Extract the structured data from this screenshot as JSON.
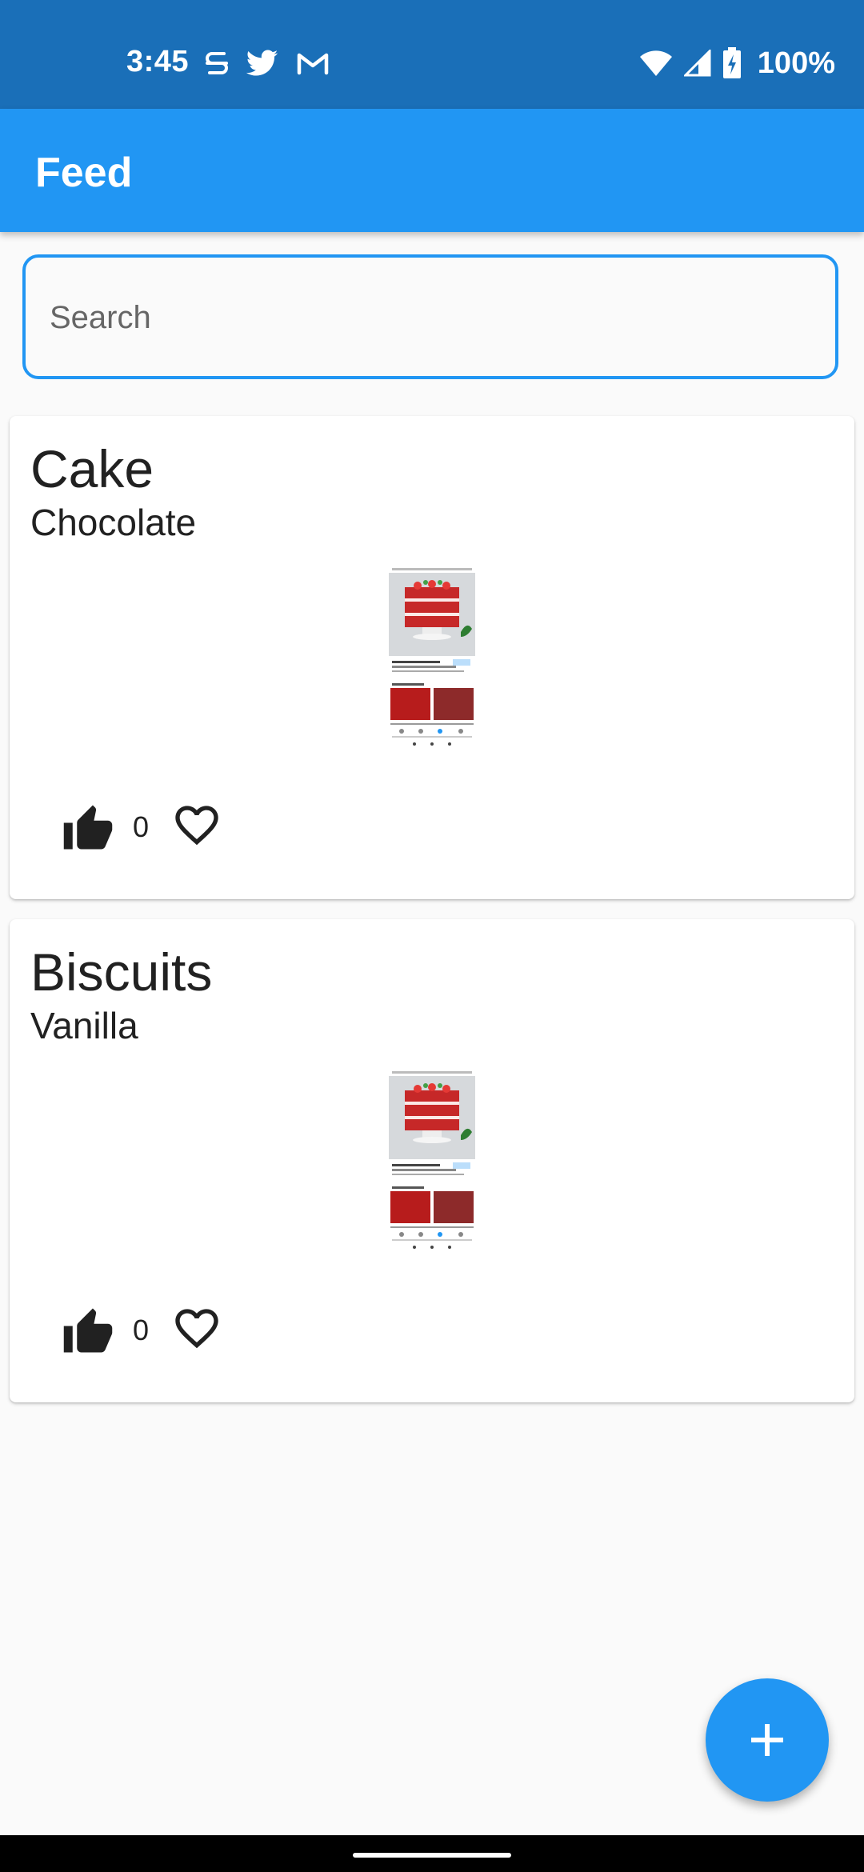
{
  "status_bar": {
    "time": "3:45",
    "notification_icons": [
      "s-icon",
      "twitter-icon",
      "gmail-icon"
    ],
    "system_icons": [
      "wifi-icon",
      "signal-icon",
      "battery-charging-icon"
    ],
    "battery": "100%"
  },
  "app_bar": {
    "title": "Feed"
  },
  "search": {
    "placeholder": "Search",
    "value": ""
  },
  "feed": {
    "items": [
      {
        "title": "Cake",
        "subtitle": "Chocolate",
        "likes": "0",
        "image": "cake-screenshot-thumbnail"
      },
      {
        "title": "Biscuits",
        "subtitle": "Vanilla",
        "likes": "0",
        "image": "cake-screenshot-thumbnail"
      }
    ]
  },
  "fab": {
    "icon": "plus-icon"
  },
  "colors": {
    "status_bar": "#1a6fb8",
    "app_bar": "#2196f3",
    "accent": "#2196f3",
    "background": "#fafafa"
  }
}
